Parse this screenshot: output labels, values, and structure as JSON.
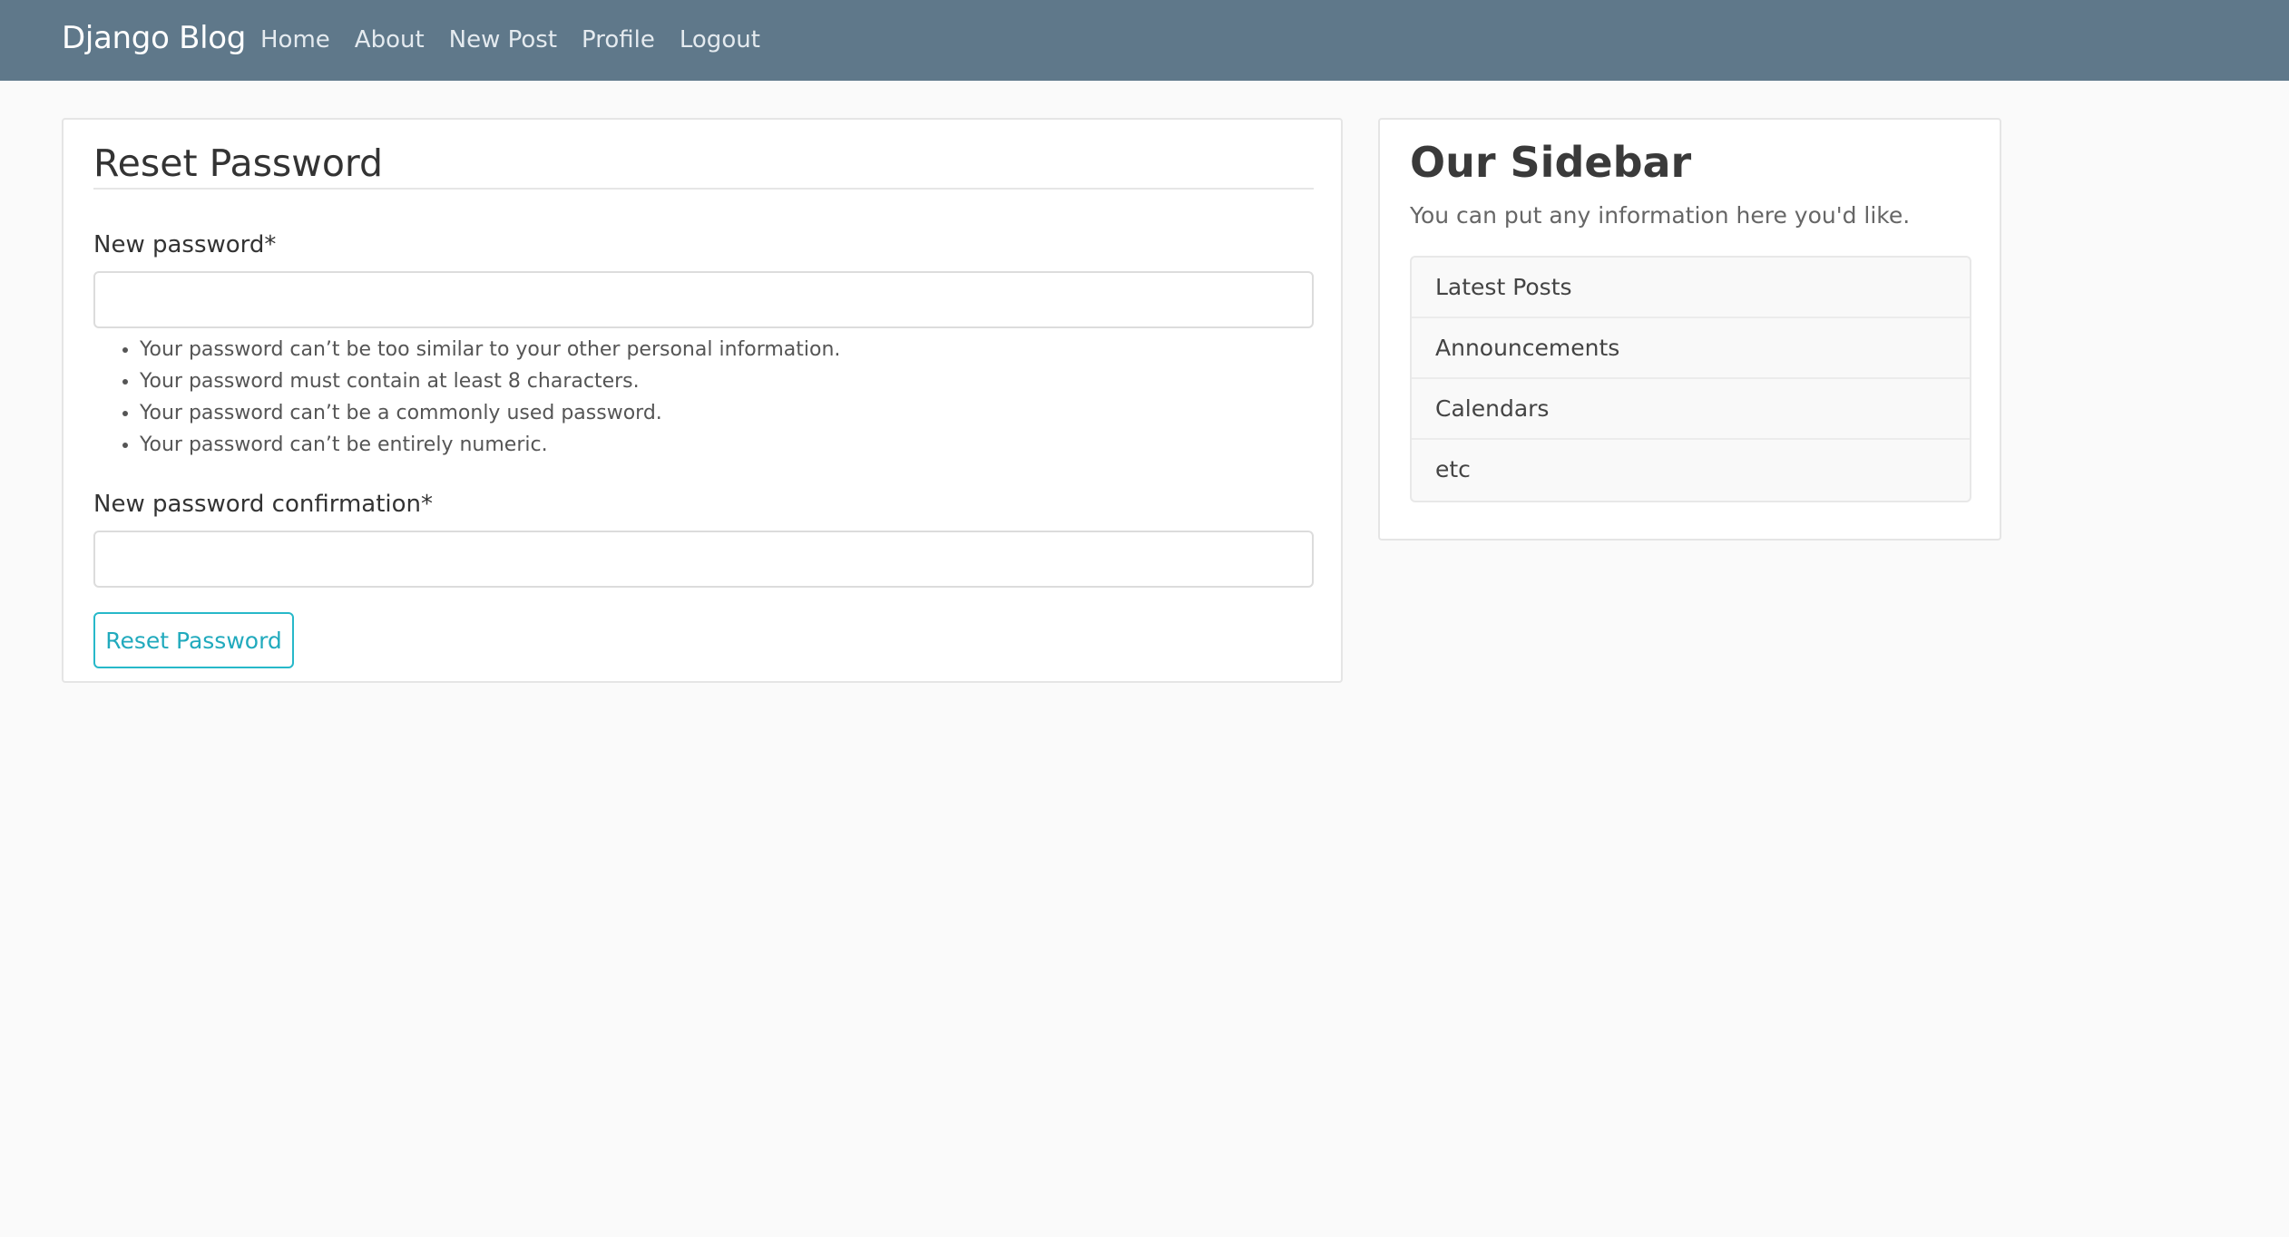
{
  "navbar": {
    "brand": "Django Blog",
    "links": [
      "Home",
      "About",
      "New Post",
      "Profile",
      "Logout"
    ],
    "background": "#5f788a"
  },
  "form": {
    "title": "Reset Password",
    "new_password_label": "New password*",
    "new_password_value": "",
    "help_items": [
      "Your password can’t be too similar to your other personal information.",
      "Your password must contain at least 8 characters.",
      "Your password can’t be a commonly used password.",
      "Your password can’t be entirely numeric."
    ],
    "confirm_label": "New password confirmation*",
    "confirm_value": "",
    "submit_label": "Reset Password",
    "accent": "#27b8c9"
  },
  "sidebar": {
    "title": "Our Sidebar",
    "text": "You can put any information here you'd like.",
    "items": [
      "Latest Posts",
      "Announcements",
      "Calendars",
      "etc"
    ]
  }
}
